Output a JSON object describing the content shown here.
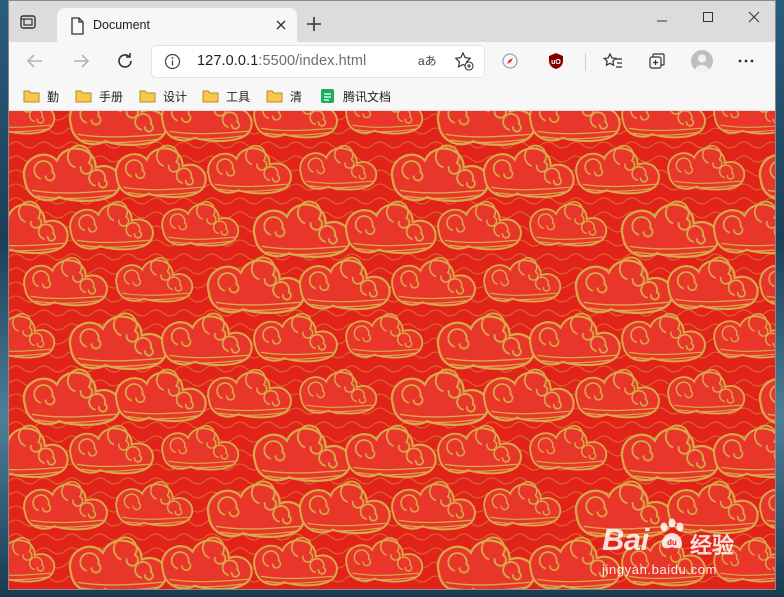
{
  "tab": {
    "title": "Document"
  },
  "address": {
    "host": "127.0.0.1",
    "rest": ":5500/index.html",
    "reader_label": "aあ"
  },
  "bookmarks": [
    {
      "label": "勤",
      "icon": "folder-icon"
    },
    {
      "label": "手册",
      "icon": "folder-icon"
    },
    {
      "label": "设计",
      "icon": "folder-icon"
    },
    {
      "label": "工具",
      "icon": "folder-icon"
    },
    {
      "label": "清",
      "icon": "folder-icon"
    },
    {
      "label": "腾讯文档",
      "icon": "tencent-docs-icon"
    }
  ],
  "colors": {
    "page_bg": "#e2231a",
    "cloud_line": "#d9a84a",
    "cloud_fill": "#e8372a"
  },
  "watermark": {
    "brand": "Bai",
    "brand_cn": "经验",
    "url": "jingyan.baidu.com"
  }
}
